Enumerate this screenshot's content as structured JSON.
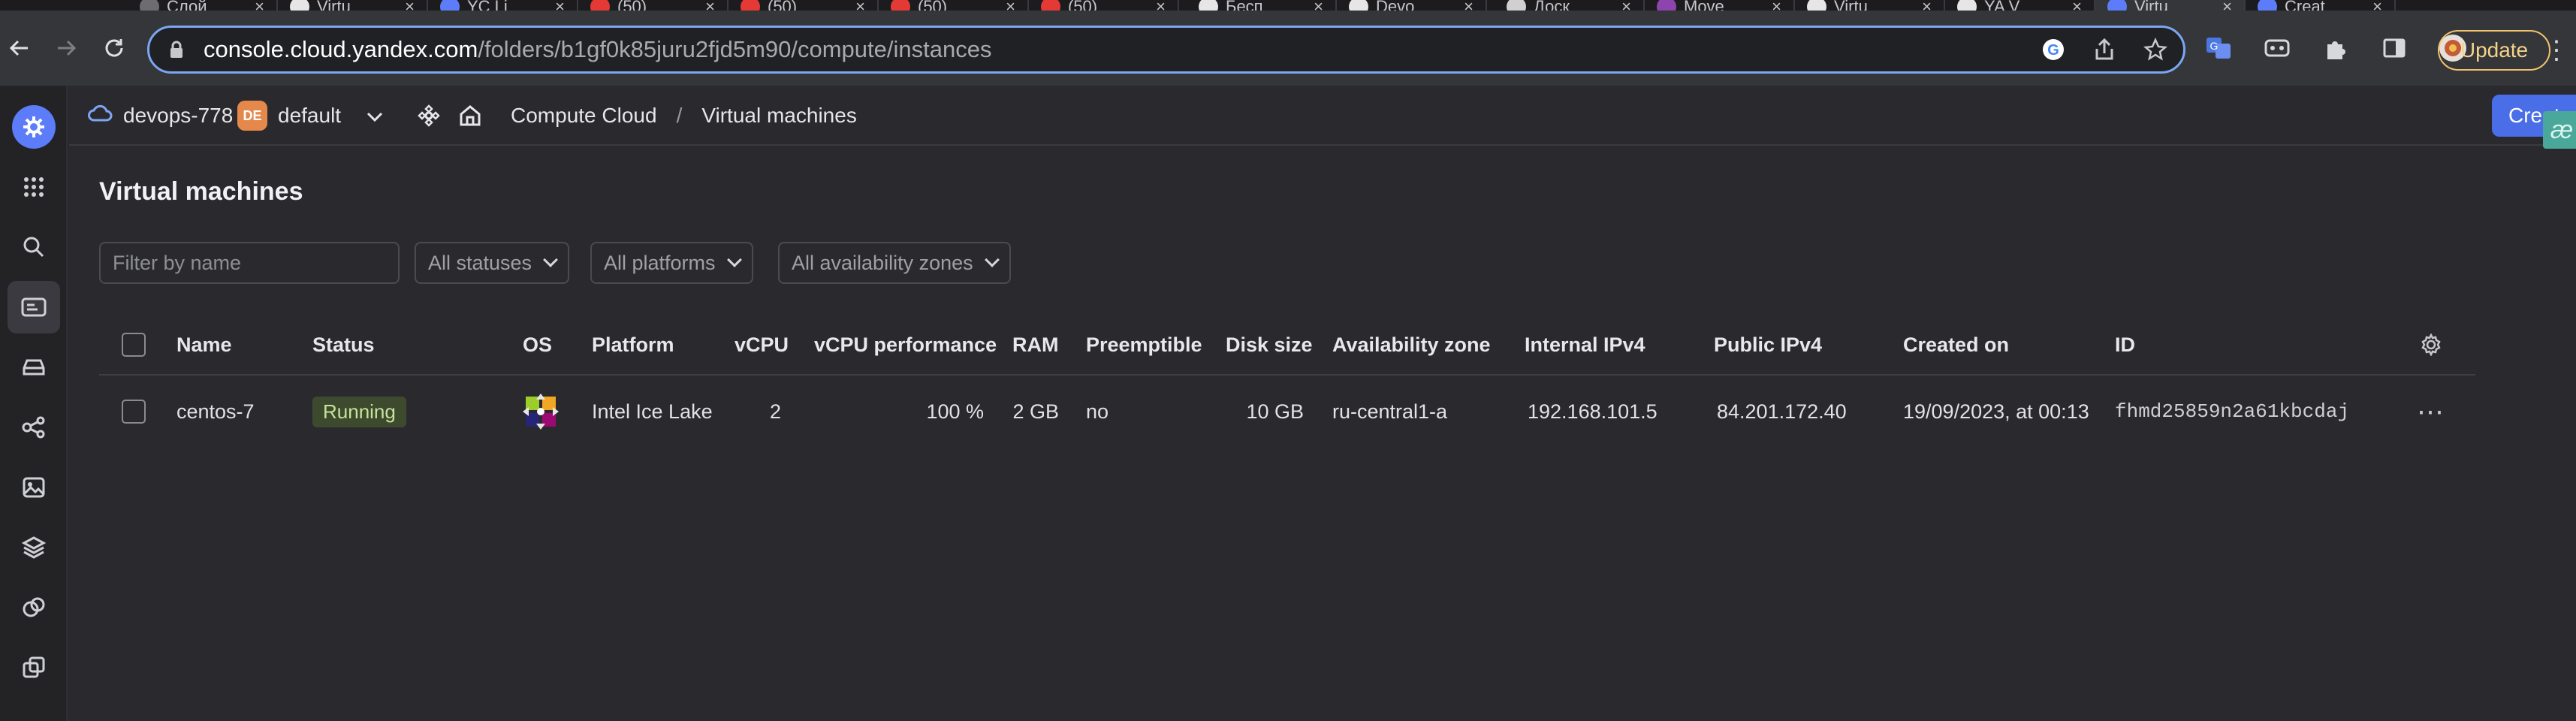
{
  "browser": {
    "tabs": [
      {
        "title": "Слой",
        "color": "#6c6c72"
      },
      {
        "title": "Virtu",
        "color": "#e6e6e6"
      },
      {
        "title": "YC Li",
        "color": "#5c7cfa"
      },
      {
        "title": "(50)",
        "color": "#e53935"
      },
      {
        "title": "(50)",
        "color": "#e53935"
      },
      {
        "title": "(50)",
        "color": "#e53935"
      },
      {
        "title": "(50)",
        "color": "#e53935"
      },
      {
        "title": "Бесп",
        "color": "#e6e6e6"
      },
      {
        "title": "Devo",
        "color": "#e6e6e6"
      },
      {
        "title": "Доск",
        "color": "#d0d0d0"
      },
      {
        "title": "Move",
        "color": "#8e44ad"
      },
      {
        "title": "Virtu",
        "color": "#e6e6e6"
      },
      {
        "title": "YA V",
        "color": "#e6e6e6"
      },
      {
        "title": "Virtu",
        "color": "#5c7cfa"
      },
      {
        "title": "Creat",
        "color": "#5c7cfa"
      }
    ],
    "url_host": "console.cloud.yandex.com",
    "url_path": "/folders/b1gf0k85juru2fjd5m90/compute/instances",
    "update_label": "Update"
  },
  "header": {
    "cloud": "devops-778",
    "folder_badge": "DE",
    "folder": "default",
    "breadcrumb_service": "Compute Cloud",
    "breadcrumb_separator": "/",
    "breadcrumb_page": "Virtual machines",
    "create_button": "Create VM",
    "ext_badge": "æ"
  },
  "page": {
    "title": "Virtual machines",
    "filter_placeholder": "Filter by name",
    "status_select": "All statuses",
    "platform_select": "All platforms",
    "zone_select": "All availability zones"
  },
  "table": {
    "columns": {
      "name": "Name",
      "status": "Status",
      "os": "OS",
      "platform": "Platform",
      "vcpu": "vCPU",
      "vcpu_perf": "vCPU performance",
      "ram": "RAM",
      "preemptible": "Preemptible",
      "disk": "Disk size",
      "zone": "Availability zone",
      "internal_ip": "Internal IPv4",
      "public_ip": "Public IPv4",
      "created": "Created on",
      "id": "ID"
    },
    "rows": [
      {
        "name": "centos-7",
        "status": "Running",
        "os_icon": "centos-logo-icon",
        "platform": "Intel Ice Lake",
        "vcpu": "2",
        "vcpu_perf": "100 %",
        "ram": "2 GB",
        "preemptible": "no",
        "disk": "10 GB",
        "zone": "ru-central1-a",
        "internal_ip": "192.168.101.5",
        "public_ip": "84.201.172.40",
        "created": "19/09/2023, at 00:13",
        "id": "fhmd25859n2a61kbcdaj"
      }
    ]
  },
  "colors": {
    "accent": "#4a6ee8",
    "running_bg": "#3d4a2e",
    "running_fg": "#c6e39a",
    "folder_badge": "#e4894b"
  }
}
